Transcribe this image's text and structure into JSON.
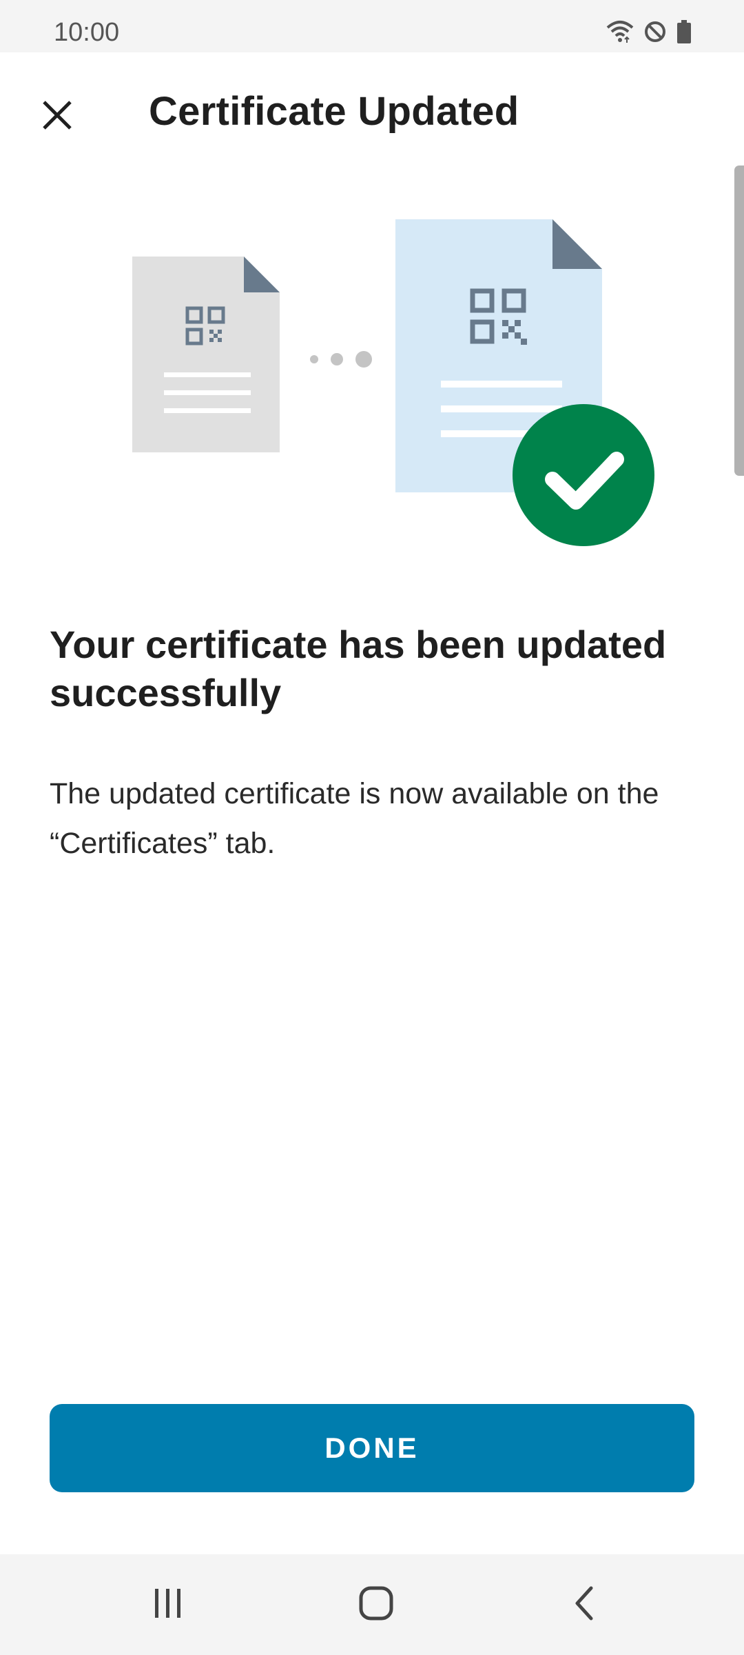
{
  "status_bar": {
    "time": "10:00",
    "icons": [
      "wifi-icon",
      "do-not-disturb-icon",
      "battery-icon"
    ]
  },
  "app_bar": {
    "title": "Certificate Updated",
    "close_icon": "close-icon"
  },
  "illustration": {
    "icons": [
      "old-certificate-icon",
      "progress-dots",
      "new-certificate-icon",
      "check-circle-icon"
    ],
    "colors": {
      "old_doc": "#e0e0e0",
      "new_doc": "#d6e9f7",
      "fold": "#687a8c",
      "qr": "#687a8c",
      "check": "#00834b"
    }
  },
  "content": {
    "headline": "Your certificate has been updated successfully",
    "body": "The updated certificate is now available on the “Certificates” tab."
  },
  "actions": {
    "done_label": "DONE",
    "accent_color": "#007dae"
  },
  "nav_bar": {
    "icons": [
      "recent-apps-icon",
      "home-icon",
      "back-icon"
    ]
  }
}
